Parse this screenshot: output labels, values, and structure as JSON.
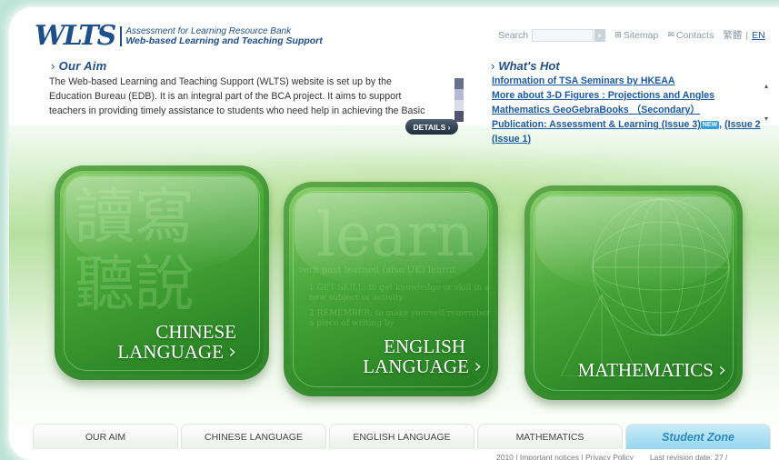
{
  "header": {
    "logo_mark": "WLTS",
    "logo_line1": "Assessment for Learning Resource Bank",
    "logo_line2": "Web-based Learning and Teaching Support"
  },
  "toplinks": {
    "search_label": "Search",
    "sitemap": "Sitemap",
    "contacts": "Contacts",
    "chinese": "繁體",
    "separator": "|",
    "english": "EN"
  },
  "aim": {
    "heading": "Our Aim",
    "text": "The Web-based Learning and Teaching Support (WLTS) website is set up by the Education Bureau (EDB). It is an integral part of the BCA project. It aims to support teachers in providing timely assistance to students who need help in achieving the Basic",
    "details_button": "DETAILS ›",
    "bar_colors": [
      "#6a6f8e",
      "#b6b9d2",
      "#dcdde9",
      "#50536f"
    ]
  },
  "hot": {
    "heading": "What's Hot",
    "items": [
      "Information of TSA Seminars by HKEAA",
      "More about 3-D Figures : Projections and Angles",
      "Mathematics GeoGebraBooks （Secondary）",
      "Publication: Assessment & Learning (Issue 3)"
    ],
    "new_badge": "NEW",
    "issue2": "(Issue 2",
    "issue1": "(Issue 1)",
    "comma": ","
  },
  "tiles": {
    "chinese": {
      "line1": "CHINESE",
      "line2": "LANGUAGE",
      "watermark": "讀寫聽說"
    },
    "english": {
      "line1": "ENGLISH",
      "line2": "LANGUAGE",
      "watermark_word": "learn",
      "watermark_line": "verb past learned (also UK) learnt",
      "watermark_1": "1 GET SKILL: to get knowledge or skill in a new subject or activity",
      "watermark_2": "2 REMEMBER: to make yourself remember a piece of writing by"
    },
    "math": {
      "line1": "MATHEMATICS"
    },
    "chevron": "›"
  },
  "nav": {
    "tabs": [
      "OUR AIM",
      "CHINESE LANGUAGE",
      "ENGLISH LANGUAGE",
      "MATHEMATICS",
      "Student Zone"
    ]
  },
  "footer": {
    "left": "2010 | Important notices | Privacy Policy",
    "revision": "Last revision date: 27 /"
  }
}
